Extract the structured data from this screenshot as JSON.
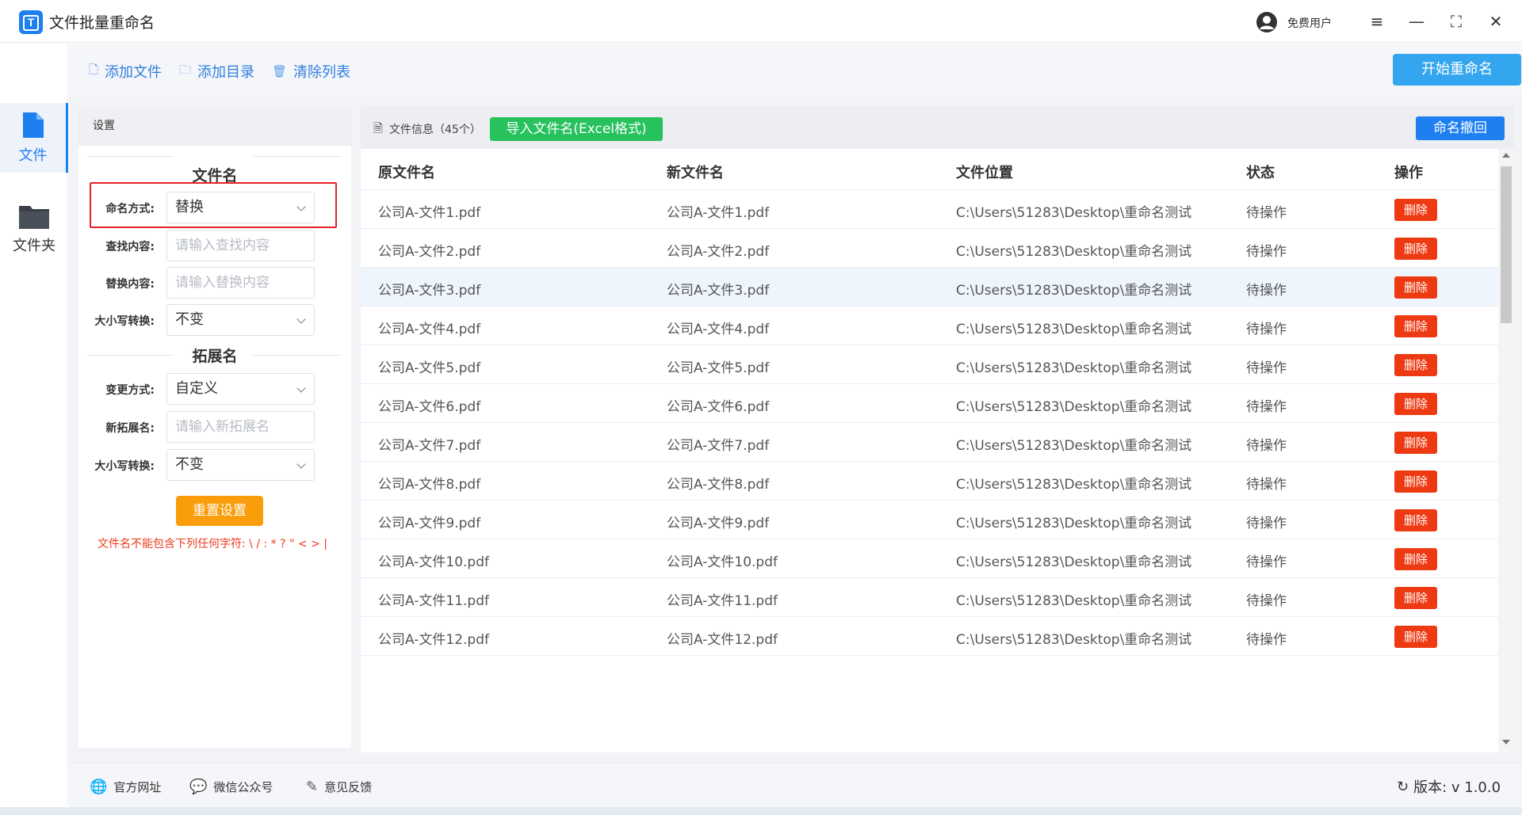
{
  "app": {
    "logo_letter": "T",
    "title": "文件批量重命名",
    "user_label": "免费用户"
  },
  "window_controls": {
    "menu": "≡",
    "minimize": "—",
    "maximize": "⛶",
    "close": "✕"
  },
  "nav": [
    {
      "label": "文件",
      "icon": "file-icon",
      "active": true
    },
    {
      "label": "文件夹",
      "icon": "folder-icon",
      "active": false
    }
  ],
  "toolbar": {
    "add_file": "添加文件",
    "add_dir": "添加目录",
    "clear_list": "清除列表",
    "start": "开始重命名"
  },
  "settings": {
    "header": "设置",
    "filename_title": "文件名",
    "naming_mode_label": "命名方式:",
    "naming_mode_value": "替换",
    "find_label": "查找内容:",
    "find_placeholder": "请输入查找内容",
    "replace_label": "替换内容:",
    "replace_placeholder": "请输入替换内容",
    "case_label": "大小写转换:",
    "case_value": "不变",
    "ext_title": "拓展名",
    "ext_mode_label": "变更方式:",
    "ext_mode_value": "自定义",
    "new_ext_label": "新拓展名:",
    "new_ext_placeholder": "请输入新拓展名",
    "ext_case_label": "大小写转换:",
    "ext_case_value": "不变",
    "reset": "重置设置",
    "warning": "文件名不能包含下列任何字符: \\ / : * ? \" < > |"
  },
  "files": {
    "info_label": "文件信息（45个）",
    "import_btn": "导入文件名(Excel格式)",
    "undo_btn": "命名撤回",
    "headers": {
      "original": "原文件名",
      "new": "新文件名",
      "location": "文件位置",
      "status": "状态",
      "action": "操作"
    },
    "delete_label": "删除",
    "rows": [
      {
        "original": "公司A-文件1.pdf",
        "new": "公司A-文件1.pdf",
        "location": "C:\\Users\\51283\\Desktop\\重命名测试",
        "status": "待操作"
      },
      {
        "original": "公司A-文件2.pdf",
        "new": "公司A-文件2.pdf",
        "location": "C:\\Users\\51283\\Desktop\\重命名测试",
        "status": "待操作"
      },
      {
        "original": "公司A-文件3.pdf",
        "new": "公司A-文件3.pdf",
        "location": "C:\\Users\\51283\\Desktop\\重命名测试",
        "status": "待操作"
      },
      {
        "original": "公司A-文件4.pdf",
        "new": "公司A-文件4.pdf",
        "location": "C:\\Users\\51283\\Desktop\\重命名测试",
        "status": "待操作"
      },
      {
        "original": "公司A-文件5.pdf",
        "new": "公司A-文件5.pdf",
        "location": "C:\\Users\\51283\\Desktop\\重命名测试",
        "status": "待操作"
      },
      {
        "original": "公司A-文件6.pdf",
        "new": "公司A-文件6.pdf",
        "location": "C:\\Users\\51283\\Desktop\\重命名测试",
        "status": "待操作"
      },
      {
        "original": "公司A-文件7.pdf",
        "new": "公司A-文件7.pdf",
        "location": "C:\\Users\\51283\\Desktop\\重命名测试",
        "status": "待操作"
      },
      {
        "original": "公司A-文件8.pdf",
        "new": "公司A-文件8.pdf",
        "location": "C:\\Users\\51283\\Desktop\\重命名测试",
        "status": "待操作"
      },
      {
        "original": "公司A-文件9.pdf",
        "new": "公司A-文件9.pdf",
        "location": "C:\\Users\\51283\\Desktop\\重命名测试",
        "status": "待操作"
      },
      {
        "original": "公司A-文件10.pdf",
        "new": "公司A-文件10.pdf",
        "location": "C:\\Users\\51283\\Desktop\\重命名测试",
        "status": "待操作"
      },
      {
        "original": "公司A-文件11.pdf",
        "new": "公司A-文件11.pdf",
        "location": "C:\\Users\\51283\\Desktop\\重命名测试",
        "status": "待操作"
      },
      {
        "original": "公司A-文件12.pdf",
        "new": "公司A-文件12.pdf",
        "location": "C:\\Users\\51283\\Desktop\\重命名测试",
        "status": "待操作"
      }
    ]
  },
  "footer": {
    "website": "官方网址",
    "wechat": "微信公众号",
    "feedback": "意见反馈",
    "version": "版本: v 1.0.0"
  },
  "colors": {
    "accent": "#1e7ff0",
    "delete": "#ee3a12",
    "import": "#27c25e",
    "reset": "#fa9d0a",
    "highlight": "#e3222a"
  }
}
